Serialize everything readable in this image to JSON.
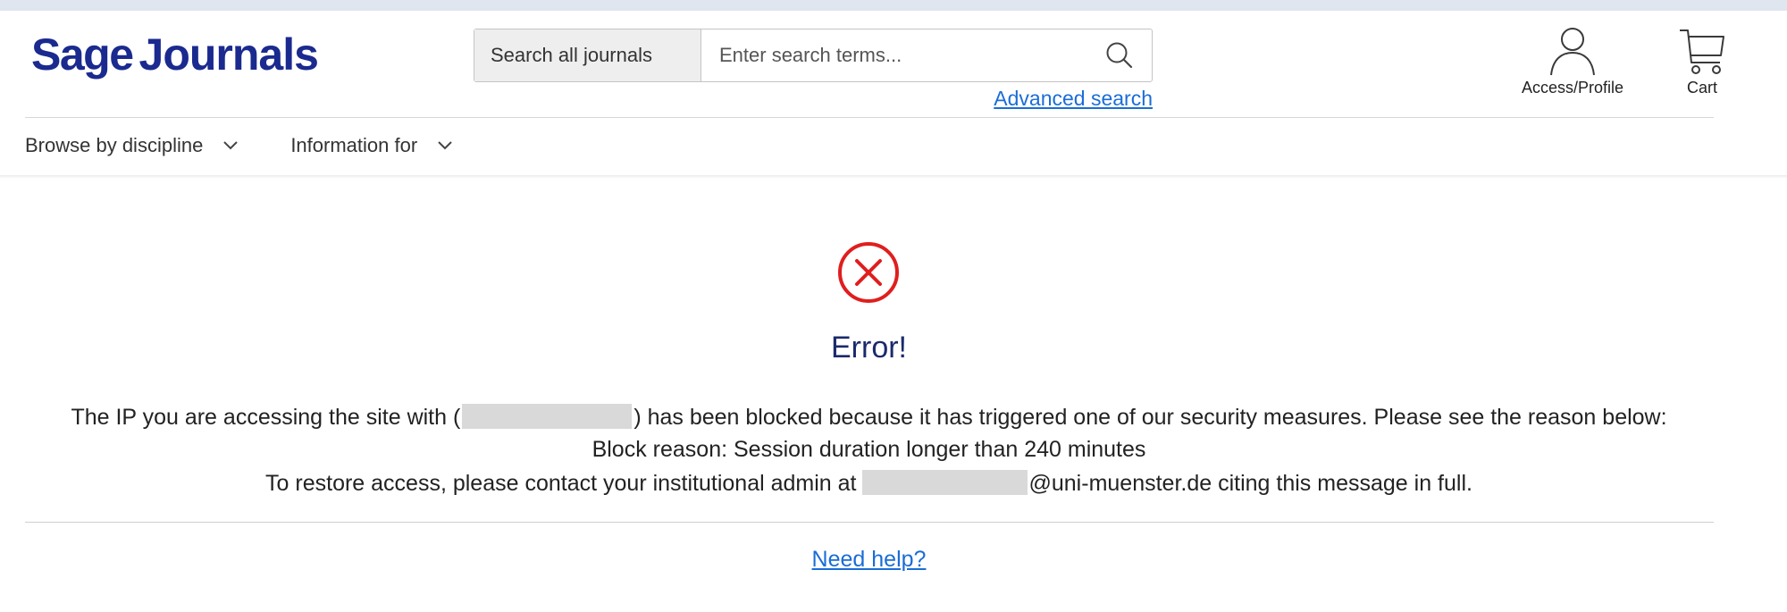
{
  "header": {
    "logo": {
      "part1": "Sage",
      "part2": "Journals"
    },
    "search": {
      "scope_label": "Search all journals",
      "placeholder": "Enter search terms...",
      "advanced_label": "Advanced search"
    },
    "profile_label": "Access/Profile",
    "cart_label": "Cart"
  },
  "nav": {
    "items": [
      {
        "label": "Browse by discipline"
      },
      {
        "label": "Information for"
      }
    ]
  },
  "error": {
    "title": "Error!",
    "line1_before": "The IP you are accessing the site with (",
    "line1_after": ") has been blocked because it has triggered one of our security measures. Please see the reason below:",
    "line2": "Block reason: Session duration longer than 240 minutes",
    "line3_before": "To restore access, please contact your institutional admin at",
    "line3_after": "@uni-muenster.de citing this message in full.",
    "help_label": "Need help?"
  },
  "colors": {
    "brand": "#1b2a8f",
    "link": "#1a6dd6",
    "error": "#e01e1e"
  }
}
